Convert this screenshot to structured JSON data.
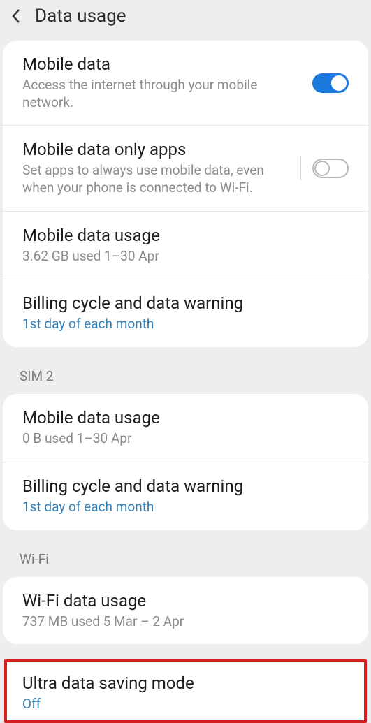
{
  "header": {
    "title": "Data usage"
  },
  "section1": {
    "mobile_data": {
      "title": "Mobile data",
      "sub": "Access the internet through your mobile network."
    },
    "only_apps": {
      "title": "Mobile data only apps",
      "sub": "Set apps to always use mobile data, even when your phone is connected to Wi-Fi."
    },
    "usage": {
      "title": "Mobile data usage",
      "sub": "3.62 GB used 1–30 Apr"
    },
    "billing": {
      "title": "Billing cycle and data warning",
      "sub": "1st day of each month"
    }
  },
  "section2": {
    "label": "SIM 2",
    "usage": {
      "title": "Mobile data usage",
      "sub": "0 B used 1–30 Apr"
    },
    "billing": {
      "title": "Billing cycle and data warning",
      "sub": "1st day of each month"
    }
  },
  "section3": {
    "label": "Wi-Fi",
    "usage": {
      "title": "Wi-Fi data usage",
      "sub": "737 MB used 5 Mar – 2 Apr"
    }
  },
  "section4": {
    "ultra": {
      "title": "Ultra data saving mode",
      "sub": "Off"
    }
  }
}
